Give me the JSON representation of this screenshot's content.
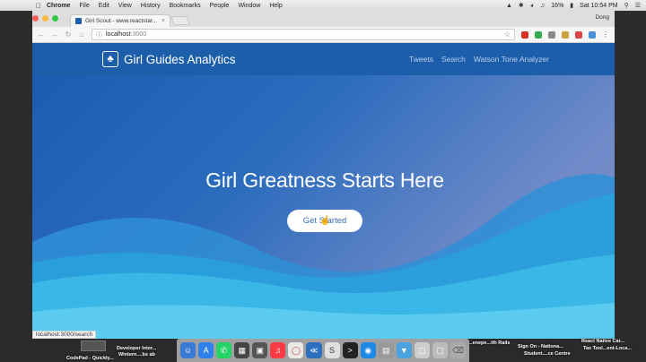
{
  "menubar": {
    "app_name": "Chrome",
    "menus": [
      "File",
      "Edit",
      "View",
      "History",
      "Bookmarks",
      "People",
      "Window",
      "Help"
    ],
    "battery": "16%",
    "clock": "Sat 10:54 PM"
  },
  "browser": {
    "tab_title": "Girl Scout - www.reactstar...",
    "tab_close": "×",
    "profile": "Dong",
    "address_host": "localhost",
    "address_port": ":3000",
    "status_url": "localhost:3000/search"
  },
  "site": {
    "brand": "Girl Guides Analytics",
    "nav": [
      "Tweets",
      "Search",
      "Watson Tone Analyzer"
    ],
    "hero_title": "Girl Greatness Starts Here",
    "cta_label": "Get Started"
  },
  "desktop": {
    "left_labels": [
      "Developer Inter...",
      "Wintern....bs ab",
      "CodePad - Quickly..."
    ],
    "right_labels": [
      "...enepe...ith Rails",
      "Sign On - Nationa...",
      "Student....ce Centre",
      "React Native Car...",
      "Tax Tool...ent-Loca..."
    ]
  },
  "colors": {
    "brand_blue": "#1d5eab",
    "cta_text": "#3b6db8"
  }
}
